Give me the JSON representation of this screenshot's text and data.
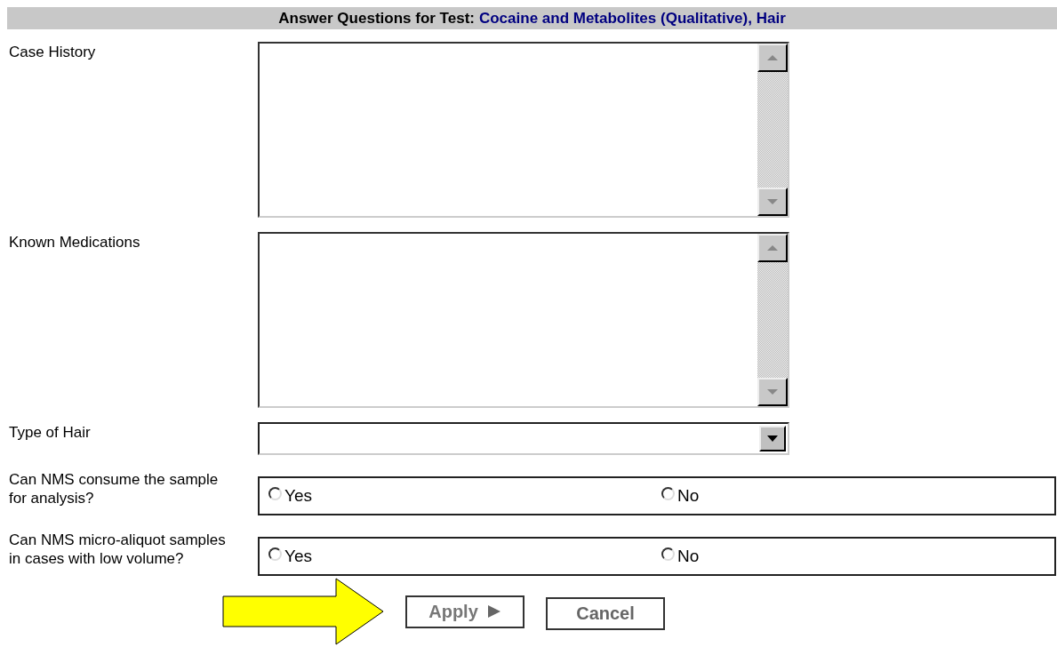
{
  "header": {
    "label": "Answer Questions for Test:",
    "test_name": "Cocaine and Metabolites (Qualitative), Hair"
  },
  "questions": [
    {
      "kind": "textarea",
      "label": "Case History"
    },
    {
      "kind": "textarea",
      "label": "Known Medications"
    },
    {
      "kind": "select",
      "label": "Type of Hair"
    },
    {
      "kind": "radio",
      "label": "Can NMS consume the sample for analysis?",
      "options": [
        {
          "label": "Yes",
          "selected": false
        },
        {
          "label": "No",
          "selected": false
        }
      ]
    },
    {
      "kind": "radio",
      "label": "Can NMS micro-aliquot samples in cases with low volume?",
      "options": [
        {
          "label": "Yes",
          "selected": false
        },
        {
          "label": "No",
          "selected": false
        }
      ]
    }
  ],
  "buttons": [
    {
      "label": "Apply",
      "kind": "apply",
      "disabled": true
    },
    {
      "label": "Cancel",
      "kind": "cancel",
      "disabled": false
    }
  ],
  "pointer_arrow": true
}
